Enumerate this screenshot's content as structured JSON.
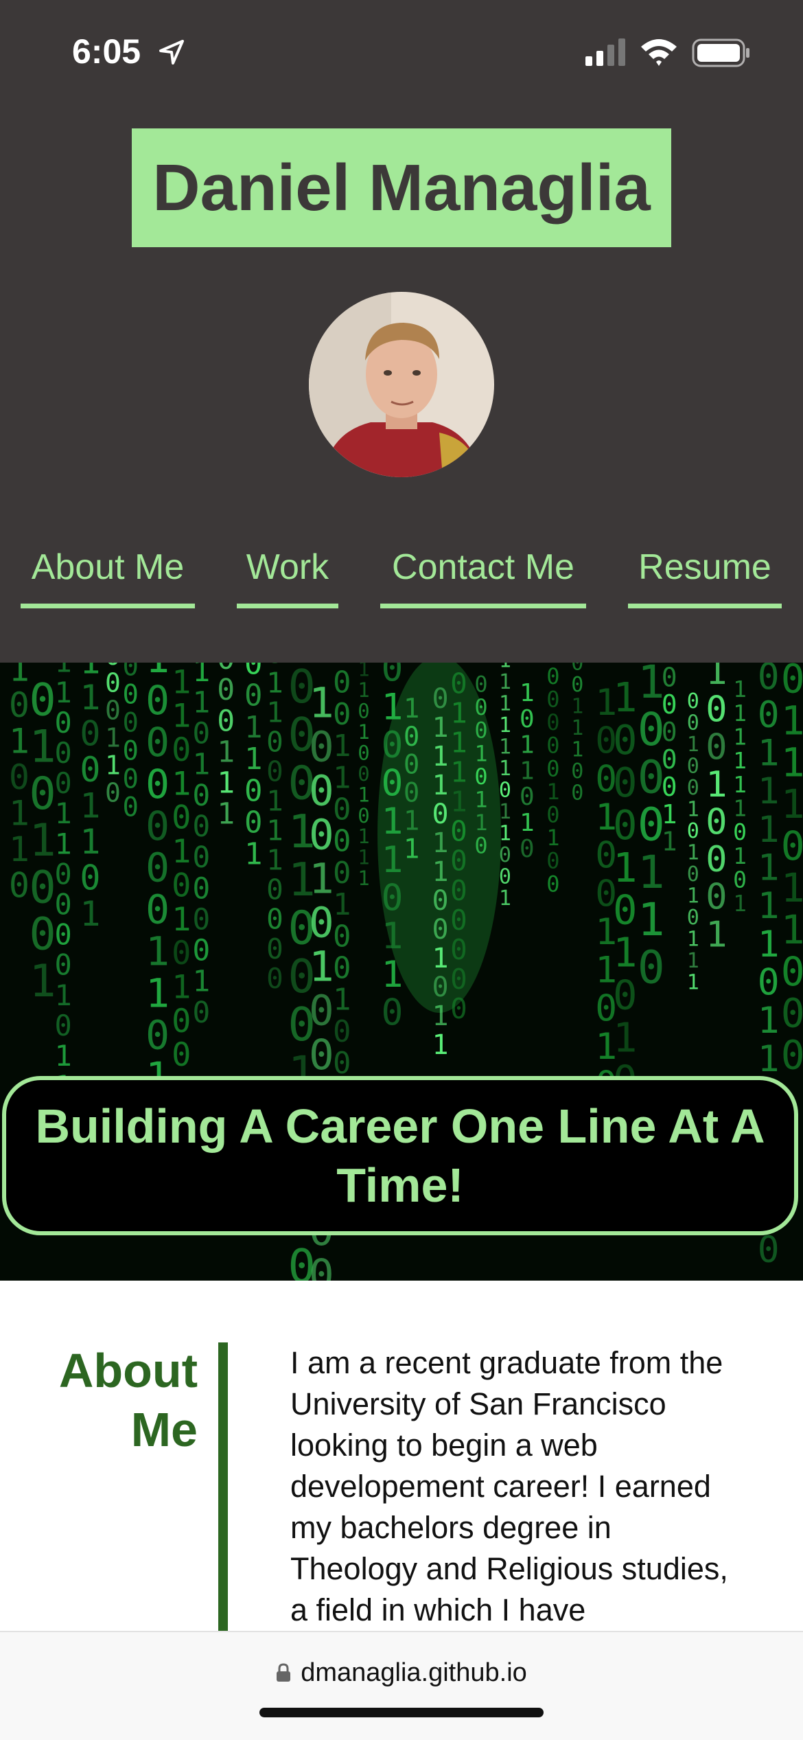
{
  "status_bar": {
    "time": "6:05",
    "icons": [
      "location-arrow-icon",
      "cellular-signal-icon",
      "wifi-icon",
      "battery-icon"
    ]
  },
  "header": {
    "name": "Daniel Managlia",
    "avatar": "profile-photo"
  },
  "nav": {
    "items": [
      {
        "label": "About Me"
      },
      {
        "label": "Work"
      },
      {
        "label": "Contact Me"
      },
      {
        "label": "Resume"
      }
    ]
  },
  "hero": {
    "banner_text": "Building A Career One Line At A Time!",
    "background": "green-binary-code-rain"
  },
  "about": {
    "heading": "About Me",
    "body": "I am a recent graduate from the University of San Francisco looking to begin a web developement career! I earned my bachelors degree in Theology and Religious studies, a field in which I have"
  },
  "browser": {
    "url": "dmanaglia.github.io"
  },
  "colors": {
    "header_bg": "#3c3838",
    "accent_light_green": "#a3e898",
    "accent_dark_green": "#2c6621",
    "banner_bg": "#000000"
  }
}
